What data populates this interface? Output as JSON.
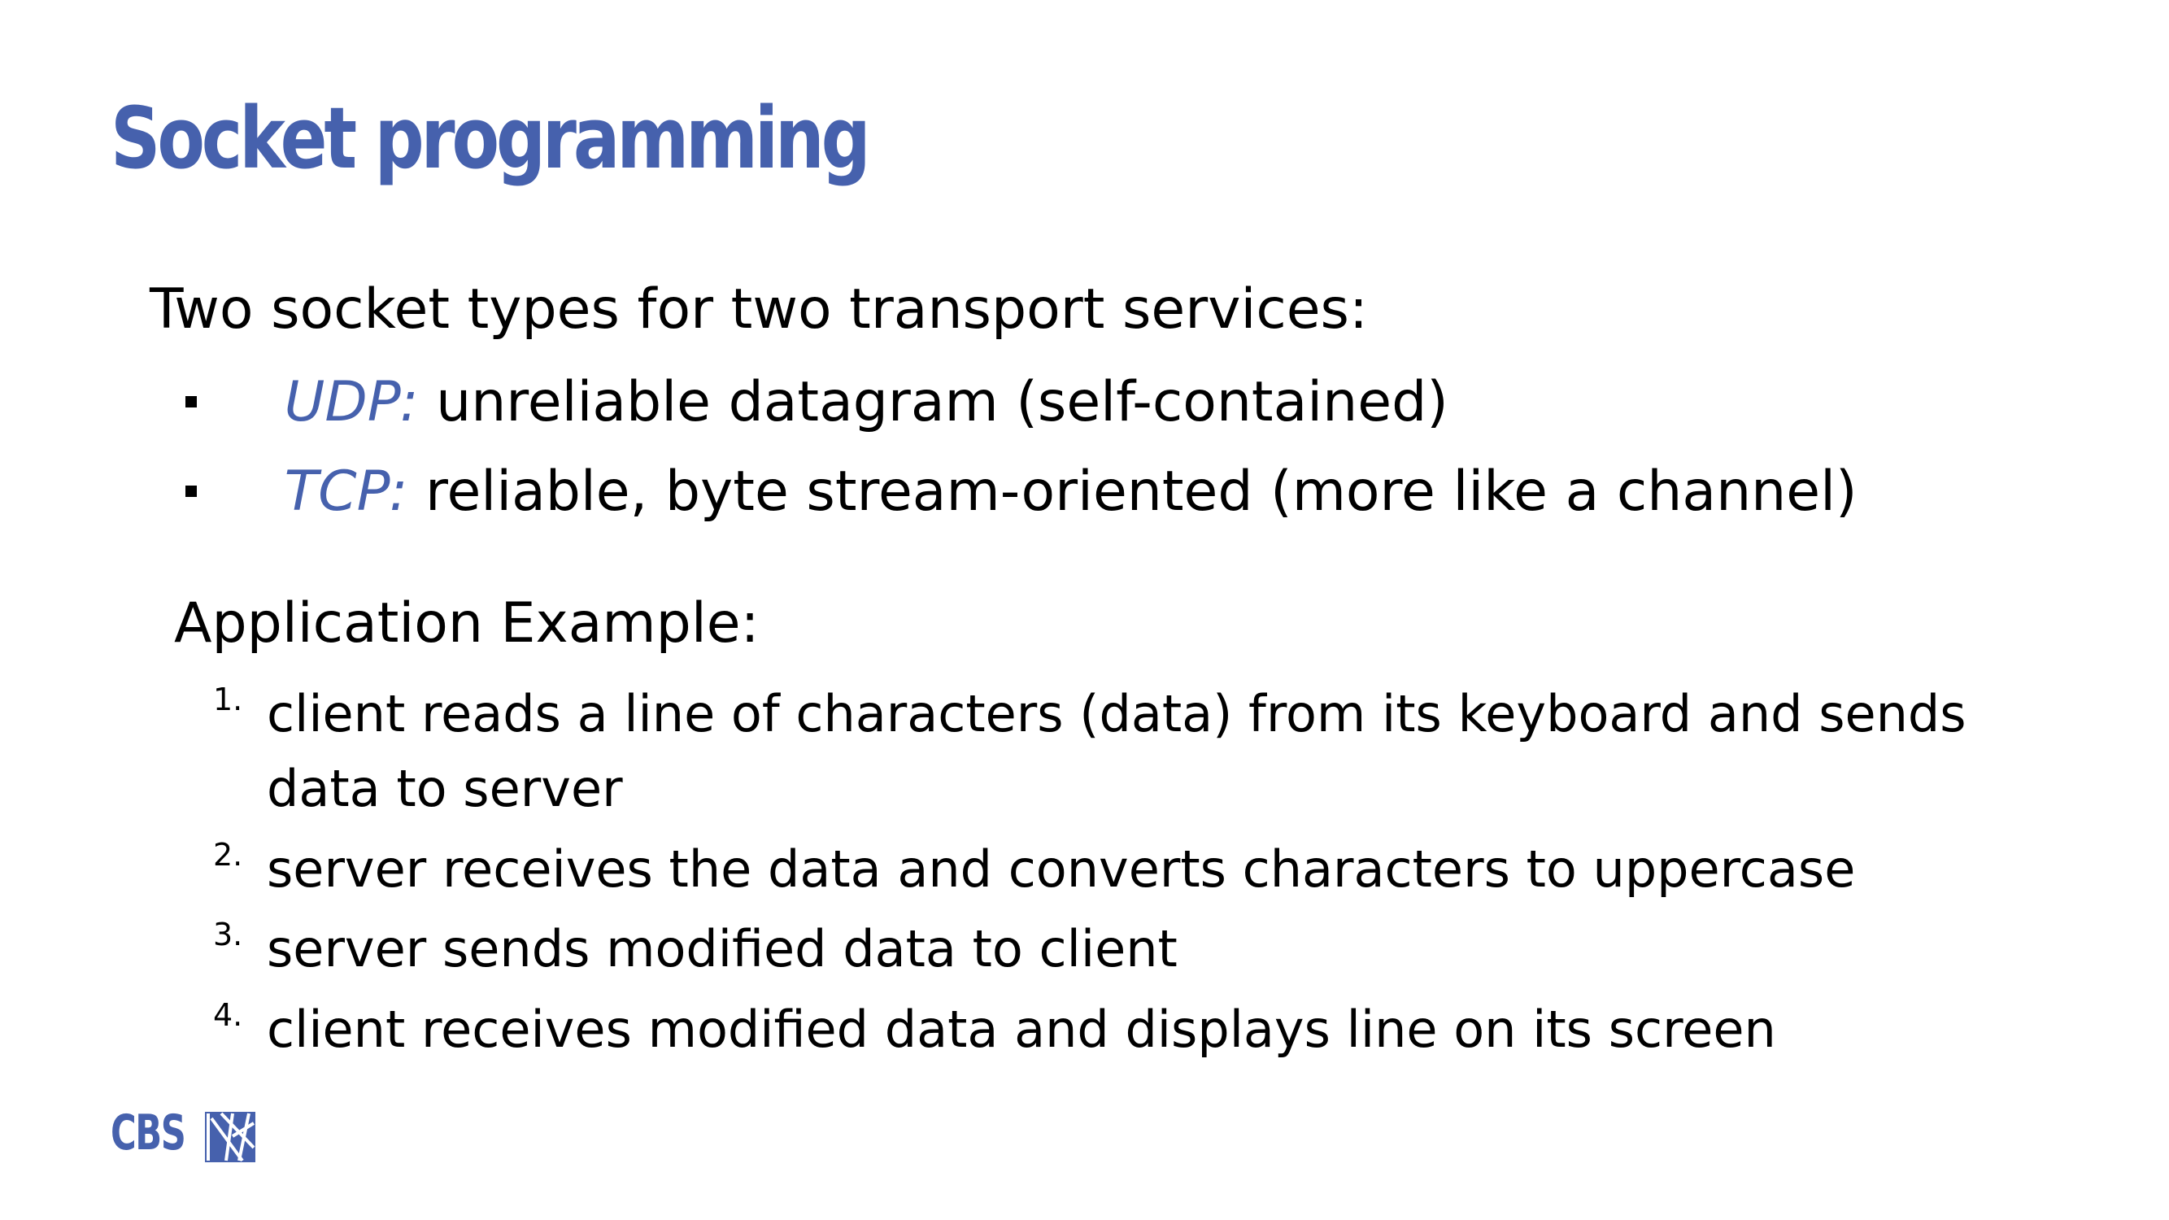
{
  "slide": {
    "title": "Socket programming",
    "intro": "Two socket types for two transport services:",
    "bullets": [
      {
        "protocol": "UDP:",
        "description": " unreliable datagram (self-contained)"
      },
      {
        "protocol": "TCP:",
        "description": " reliable, byte stream-oriented (more like a channel)"
      }
    ],
    "application_title": "Application Example:",
    "steps": [
      {
        "number": "1.",
        "text": "client reads a line of characters (data) from its keyboard and sends data to server"
      },
      {
        "number": "2.",
        "text": "server receives the data and converts characters to uppercase"
      },
      {
        "number": "3.",
        "text": "server sends modified data to client"
      },
      {
        "number": "4.",
        "text": "client receives modified data and displays line on its screen"
      }
    ],
    "logo_text": "CBS",
    "logo_mark_icon": "cbs-logo-icon"
  },
  "colors": {
    "accent": "#4661ad",
    "text": "#000000",
    "background": "#ffffff"
  }
}
